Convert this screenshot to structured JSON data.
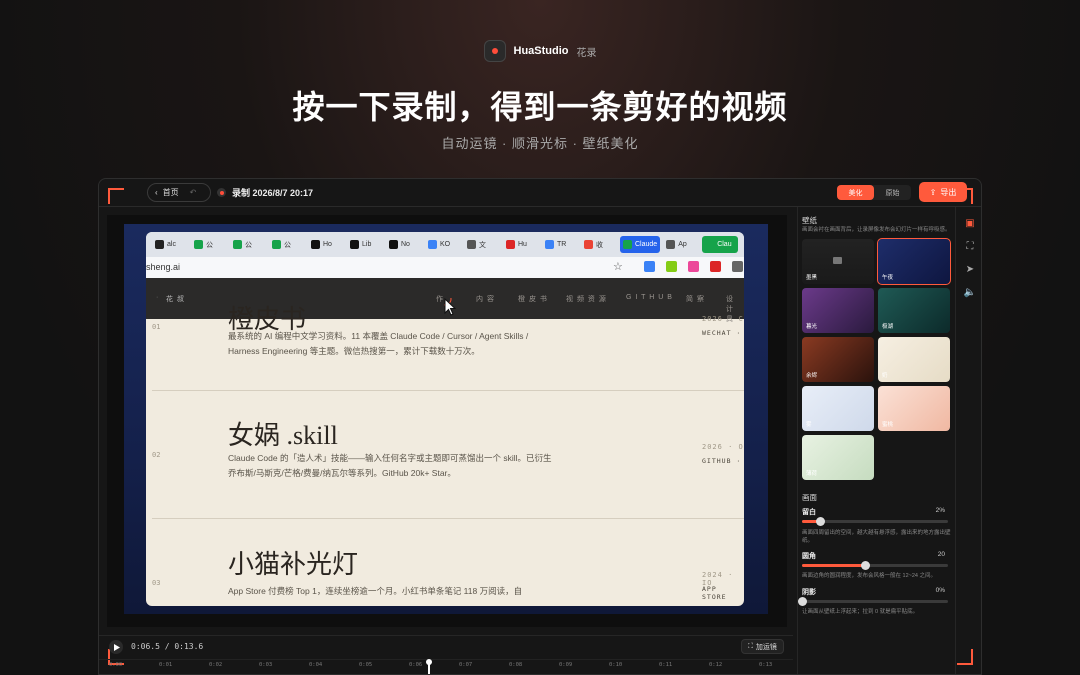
{
  "brand": {
    "name": "HuaStudio",
    "cn": "花录"
  },
  "headline": "按一下录制，得到一条剪好的视频",
  "subline": "自动运镜 · 顺滑光标 · 壁纸美化",
  "topbar": {
    "home_label": "首页",
    "record_title": "录制 2026/8/7 20:17",
    "seg_beautify": "美化",
    "seg_original": "原始",
    "export_label": "导出"
  },
  "browser": {
    "tabs": [
      {
        "label": "alc",
        "icon": "github-icon"
      },
      {
        "label": "公",
        "icon": "wechat-icon"
      },
      {
        "label": "公",
        "icon": "wechat-icon"
      },
      {
        "label": "公",
        "icon": "wechat-icon"
      },
      {
        "label": "Ho",
        "icon": "x-icon"
      },
      {
        "label": "Lib",
        "icon": "app-icon"
      },
      {
        "label": "No",
        "icon": "x-icon"
      },
      {
        "label": "KO",
        "icon": "doc-icon"
      },
      {
        "label": "文",
        "icon": "globe-icon"
      },
      {
        "label": "Hu",
        "icon": "record-icon"
      },
      {
        "label": "TR",
        "icon": "doc-icon"
      },
      {
        "label": "收",
        "icon": "gmail-icon"
      },
      {
        "label": "Claude",
        "icon": "check-icon"
      },
      {
        "label": "Ap",
        "icon": "apple-icon"
      },
      {
        "label": "Clau",
        "icon": "check-icon"
      }
    ],
    "url": "sheng.ai",
    "site_nav": {
      "brand": "花 叔",
      "items": [
        "作",
        "内 容",
        "橙 皮 书",
        "视 频 资 源",
        "G I T H U B",
        "简 察",
        "设 计 具"
      ]
    },
    "entries": [
      {
        "num": "01",
        "title": "橙皮书",
        "desc": "最系统的 AI 编程中文学习资料。11 本覆盖 Claude Code / Cursor / Agent Skills / Harness Engineering 等主题。微信热搜第一，累计下载数十万次。",
        "meta": "2026 · C",
        "meta2": "WECHAT ·"
      },
      {
        "num": "02",
        "title": "女娲 .skill",
        "desc": "Claude Code 的「造人术」技能——输入任何名字或主题即可蒸馏出一个 skill。已衍生乔布斯/马斯克/芒格/费曼/纳瓦尔等系列。GitHub 20k+ Star。",
        "meta": "2026 · O",
        "meta2": "GITHUB ·"
      },
      {
        "num": "03",
        "title": "小猫补光灯",
        "desc": "App Store 付费榜 Top 1，连续坐榜逾一个月。小红书单条笔记 118 万阅读，自",
        "meta": "2024 · IO",
        "meta2": "APP STORE"
      }
    ]
  },
  "transport": {
    "current": "0:06.5",
    "total": "0:13.6",
    "time_text": "0:06.5 / 0:13.6",
    "add_camera": "加运镜",
    "progress": 0.478
  },
  "ruler_ticks": [
    "0:00",
    "0:01",
    "0:02",
    "0:03",
    "0:04",
    "0:05",
    "0:06",
    "0:07",
    "0:08",
    "0:09",
    "0:10",
    "0:11",
    "0:12",
    "0:13"
  ],
  "panel": {
    "wallpaper_title": "壁纸",
    "wallpaper_desc": "画面会衬在画面背后，让录屏像发布会幻灯片一样有呼吸感。",
    "wallpapers": [
      {
        "label": "墨黑"
      },
      {
        "label": "午夜",
        "selected": true
      },
      {
        "label": "暮光"
      },
      {
        "label": "极湖"
      },
      {
        "label": "余烬"
      },
      {
        "label": "奶"
      },
      {
        "label": "雾"
      },
      {
        "label": "蜜桃"
      },
      {
        "label": "薄荷"
      }
    ],
    "canvas_title": "画面",
    "padding": {
      "label": "留白",
      "value": "2%",
      "level": 0.12,
      "desc": "画面四周留出的空间，越大越有悬浮感，露出来的地方露出壁纸。"
    },
    "radius": {
      "label": "圆角",
      "value": "20",
      "level": 0.43,
      "desc": "画面边角的圆润程度，发布会风格一般在 12~24 之间。"
    },
    "shadow": {
      "label": "阴影",
      "value": "0%",
      "level": 0.0,
      "desc": "让画面从壁纸上浮起来；拉到 0 就是扁平贴底。"
    }
  },
  "colors": {
    "accent": "#ff5a3c",
    "selected_tab": "#2563eb",
    "wall": "#1a2a5e"
  }
}
